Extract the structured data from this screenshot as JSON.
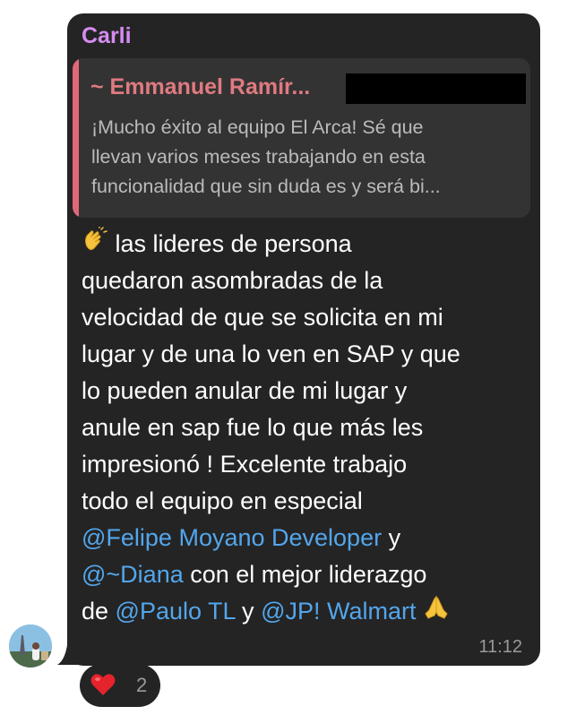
{
  "message": {
    "sender": "Carli",
    "reply": {
      "author": "~ Emmanuel Ramír...",
      "lines": [
        "¡Mucho éxito al equipo El Arca! Sé que",
        "llevan varios meses trabajando en esta",
        "funcionalidad que sin duda es y será bi..."
      ]
    },
    "body": {
      "line1": "las lideres de persona",
      "line2": "quedaron asombradas de la",
      "line3": "velocidad de que se solicita en mi",
      "line4": "lugar y de una lo ven en SAP y que",
      "line5": "lo pueden anular de mi lugar y",
      "line6": "anule en sap fue lo que más les",
      "line7": "impresionó !  Excelente trabajo",
      "line8": "todo el equipo en especial",
      "mention1": "@Felipe Moyano Developer",
      "after_mention1": " y",
      "mention2": "@~Diana",
      "after_mention2": "  con el mejor liderazgo",
      "before_mention3": "de ",
      "mention3": "@Paulo TL",
      "between_mentions": " y ",
      "mention4": "@JP! Walmart"
    },
    "time": "11:12"
  },
  "reaction": {
    "emoji": "heart-icon",
    "count": "2"
  },
  "colors": {
    "bubble": "#242424",
    "sender": "#d58cf2",
    "quote_bar": "#e06878",
    "mention": "#53a6ec",
    "time": "#9a9a9a"
  }
}
